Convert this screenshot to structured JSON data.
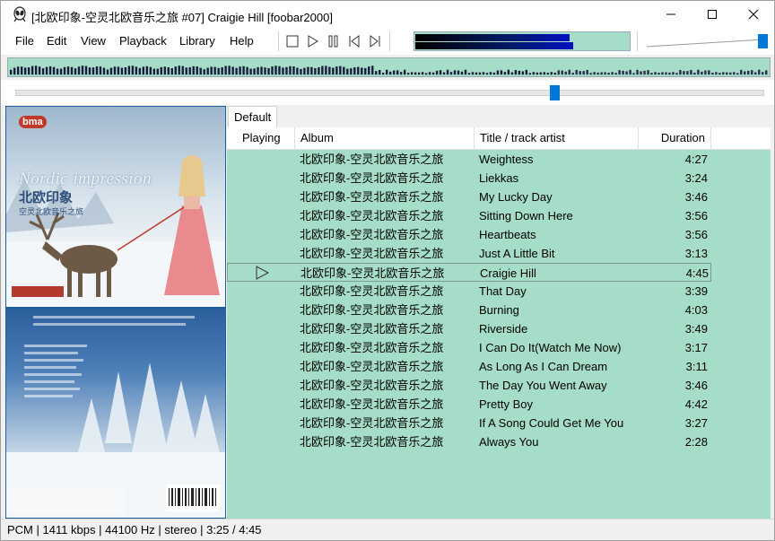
{
  "window": {
    "title": "[北欧印象-空灵北欧音乐之旅 #07] Craigie Hill  [foobar2000]",
    "controls": [
      "minimize",
      "maximize",
      "close"
    ]
  },
  "menu": [
    "File",
    "Edit",
    "View",
    "Playback",
    "Library",
    "Help"
  ],
  "toolbar": {
    "buttons": [
      "stop-icon",
      "play-icon",
      "pause-icon",
      "previous-icon",
      "next-icon"
    ]
  },
  "colors": {
    "list_bg": "#a5ddc9",
    "accent": "#0078d7"
  },
  "playback": {
    "seek_fraction": 0.72,
    "volume_fraction": 1.0
  },
  "album_art": {
    "front_logo": "bma",
    "front_title_en": "Nordic impression",
    "front_title_cn": "北欧印象",
    "front_subtitle_cn": "空灵北欧音乐之旅"
  },
  "playlist": {
    "tab": "Default",
    "columns": {
      "playing": "Playing",
      "album": "Album",
      "title": "Title / track artist",
      "duration": "Duration"
    },
    "rows": [
      {
        "album": "北欧印象-空灵北欧音乐之旅",
        "title": "Weightess",
        "duration": "4:27"
      },
      {
        "album": "北欧印象-空灵北欧音乐之旅",
        "title": "Liekkas",
        "duration": "3:24"
      },
      {
        "album": "北欧印象-空灵北欧音乐之旅",
        "title": "My Lucky Day",
        "duration": "3:46"
      },
      {
        "album": "北欧印象-空灵北欧音乐之旅",
        "title": "Sitting Down Here",
        "duration": "3:56"
      },
      {
        "album": "北欧印象-空灵北欧音乐之旅",
        "title": "Heartbeats",
        "duration": "3:56"
      },
      {
        "album": "北欧印象-空灵北欧音乐之旅",
        "title": "Just A Little Bit",
        "duration": "3:13"
      },
      {
        "album": "北欧印象-空灵北欧音乐之旅",
        "title": "Craigie Hill",
        "duration": "4:45"
      },
      {
        "album": "北欧印象-空灵北欧音乐之旅",
        "title": "That Day",
        "duration": "3:39"
      },
      {
        "album": "北欧印象-空灵北欧音乐之旅",
        "title": "Burning",
        "duration": "4:03"
      },
      {
        "album": "北欧印象-空灵北欧音乐之旅",
        "title": "Riverside",
        "duration": "3:49"
      },
      {
        "album": "北欧印象-空灵北欧音乐之旅",
        "title": "I Can Do It(Watch Me Now)",
        "duration": "3:17"
      },
      {
        "album": "北欧印象-空灵北欧音乐之旅",
        "title": "As Long As I Can Dream",
        "duration": "3:11"
      },
      {
        "album": "北欧印象-空灵北欧音乐之旅",
        "title": "The Day You Went Away",
        "duration": "3:46"
      },
      {
        "album": "北欧印象-空灵北欧音乐之旅",
        "title": "Pretty Boy",
        "duration": "4:42"
      },
      {
        "album": "北欧印象-空灵北欧音乐之旅",
        "title": "If A Song Could Get Me You",
        "duration": "3:27"
      },
      {
        "album": "北欧印象-空灵北欧音乐之旅",
        "title": "Always You",
        "duration": "2:28"
      }
    ],
    "playing_index": 6
  },
  "status_bar": "PCM | 1411 kbps | 44100 Hz | stereo | 3:25 / 4:45"
}
